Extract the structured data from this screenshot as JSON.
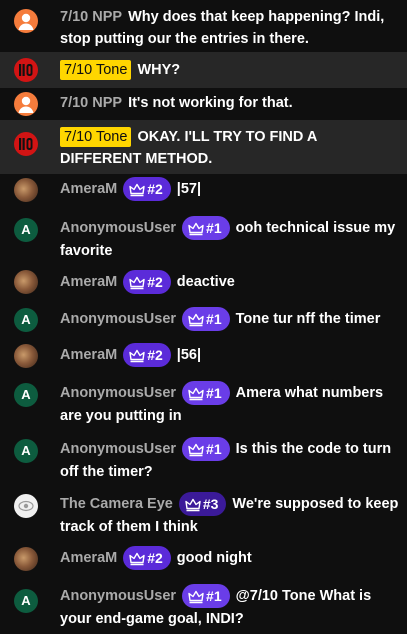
{
  "colors": {
    "background": "#0f0f0f",
    "highlight_row": "#272727",
    "owner_chip": "#ffd600",
    "member_badge": "#5b2bd9",
    "author_gray": "#aaaaaa"
  },
  "messages": [
    {
      "author": "7/10 NPP",
      "avatar": "person-icon-orange",
      "text": "Why does that keep happening? Indi, stop putting our the entries in there."
    },
    {
      "author": "7/10 Tone",
      "avatar": "red-channel-logo",
      "owner": true,
      "text": "WHY?"
    },
    {
      "author": "7/10 NPP",
      "avatar": "person-icon-orange",
      "text": "It's not working for that."
    },
    {
      "author": "7/10 Tone",
      "avatar": "red-channel-logo",
      "owner": true,
      "text": "OKAY. I'LL TRY TO FIND A DIFFERENT METHOD."
    },
    {
      "author": "AmeraM",
      "avatar": "photo-avatar",
      "badge": "#2",
      "text": "|57|"
    },
    {
      "author": "AnonymousUser",
      "avatar": "letter-a",
      "badge": "#1",
      "text": "ooh technical issue my favorite"
    },
    {
      "author": "AmeraM",
      "avatar": "photo-avatar",
      "badge": "#2",
      "text": "deactive"
    },
    {
      "author": "AnonymousUser",
      "avatar": "letter-a",
      "badge": "#1",
      "text": "Tone tur nff the timer"
    },
    {
      "author": "AmeraM",
      "avatar": "photo-avatar",
      "badge": "#2",
      "text": "|56|"
    },
    {
      "author": "AnonymousUser",
      "avatar": "letter-a",
      "badge": "#1",
      "text": "Amera what numbers are you putting in"
    },
    {
      "author": "AnonymousUser",
      "avatar": "letter-a",
      "badge": "#1",
      "text": "Is this the code to turn off the timer?"
    },
    {
      "author": "The Camera Eye",
      "avatar": "camera-eye-avatar",
      "badge": "#3",
      "text": "We're supposed to keep track of them I think"
    },
    {
      "author": "AmeraM",
      "avatar": "photo-avatar",
      "badge": "#2",
      "text": "good night"
    },
    {
      "author": "AnonymousUser",
      "avatar": "letter-a",
      "badge": "#1",
      "text": "@7/10 Tone What is your end-game goal, INDI?"
    }
  ],
  "avatar_letter": "A"
}
